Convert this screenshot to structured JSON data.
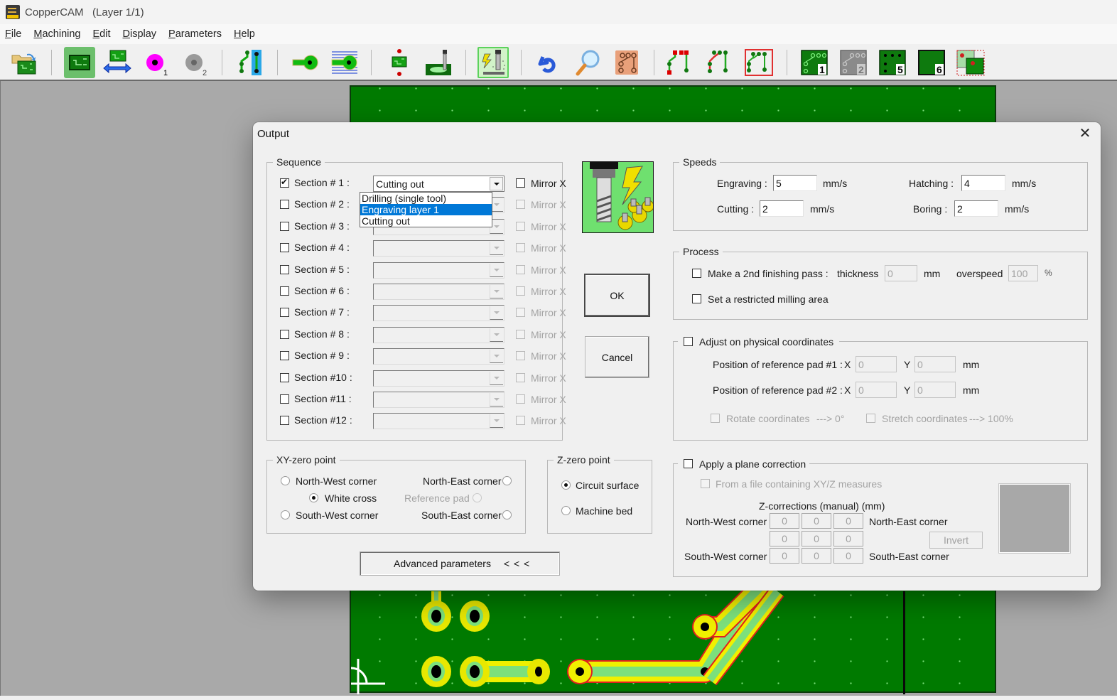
{
  "window": {
    "app_title": "CopperCAM",
    "layer_info": "(Layer 1/1)"
  },
  "menu": [
    {
      "label": "File",
      "accel": "F"
    },
    {
      "label": "Machining",
      "accel": "M"
    },
    {
      "label": "Edit",
      "accel": "E"
    },
    {
      "label": "Display",
      "accel": "D"
    },
    {
      "label": "Parameters",
      "accel": "P"
    },
    {
      "label": "Help",
      "accel": "H"
    }
  ],
  "toolbar": {
    "buttons": [
      {
        "icon": "open-folder-icon"
      },
      {
        "icon": "circuit-board-icon"
      },
      {
        "icon": "mirror-board-icon"
      },
      {
        "icon": "pad-layer-1-icon",
        "badge": "1"
      },
      {
        "icon": "pad-layer-2-icon",
        "badge": "2"
      },
      {
        "icon": "track-pad-icon"
      },
      {
        "icon": "pad-contour-icon"
      },
      {
        "icon": "pad-hatching-icon"
      },
      {
        "icon": "board-drill-icon"
      },
      {
        "icon": "cutting-tool-icon"
      },
      {
        "icon": "mill-output-icon"
      },
      {
        "icon": "undo-icon"
      },
      {
        "icon": "magnifier-icon"
      },
      {
        "icon": "copper-pcb-icon"
      },
      {
        "icon": "tracks-red-pads-icon"
      },
      {
        "icon": "tracks-red-lines-icon"
      },
      {
        "icon": "tracks-framed-icon"
      },
      {
        "icon": "layer-1-icon",
        "badge": "1"
      },
      {
        "icon": "layer-2-icon",
        "badge": "2"
      },
      {
        "icon": "layer-5-icon",
        "badge": "5"
      },
      {
        "icon": "layer-6-icon",
        "badge": "6"
      },
      {
        "icon": "board-offset-icon"
      }
    ]
  },
  "dialog": {
    "title": "Output",
    "close_glyph": "✕",
    "sequence": {
      "legend": "Sequence",
      "rows": [
        {
          "label": "Section # 1 :",
          "checked": true,
          "value": "Cutting out",
          "mirror_label": "Mirror X",
          "enabled": true
        },
        {
          "label": "Section # 2 :",
          "checked": false,
          "value": "",
          "mirror_label": "Mirror X",
          "enabled": false
        },
        {
          "label": "Section # 3 :",
          "checked": false,
          "value": "",
          "mirror_label": "Mirror X",
          "enabled": false
        },
        {
          "label": "Section # 4 :",
          "checked": false,
          "value": "",
          "mirror_label": "Mirror X",
          "enabled": false
        },
        {
          "label": "Section # 5 :",
          "checked": false,
          "value": "",
          "mirror_label": "Mirror X",
          "enabled": false
        },
        {
          "label": "Section # 6 :",
          "checked": false,
          "value": "",
          "mirror_label": "Mirror X",
          "enabled": false
        },
        {
          "label": "Section # 7 :",
          "checked": false,
          "value": "",
          "mirror_label": "Mirror X",
          "enabled": false
        },
        {
          "label": "Section # 8 :",
          "checked": false,
          "value": "",
          "mirror_label": "Mirror X",
          "enabled": false
        },
        {
          "label": "Section # 9 :",
          "checked": false,
          "value": "",
          "mirror_label": "Mirror X",
          "enabled": false
        },
        {
          "label": "Section #10 :",
          "checked": false,
          "value": "",
          "mirror_label": "Mirror X",
          "enabled": false
        },
        {
          "label": "Section #11 :",
          "checked": false,
          "value": "",
          "mirror_label": "Mirror X",
          "enabled": false
        },
        {
          "label": "Section #12 :",
          "checked": false,
          "value": "",
          "mirror_label": "Mirror X",
          "enabled": false
        }
      ],
      "dropdown_options": [
        "Drilling (single tool)",
        "Engraving layer 1",
        "Cutting out"
      ],
      "dropdown_highlighted": "Engraving layer 1"
    },
    "ok_label": "OK",
    "cancel_label": "Cancel",
    "speeds": {
      "legend": "Speeds",
      "engraving_label": "Engraving :",
      "engraving_value": "5",
      "hatching_label": "Hatching :",
      "hatching_value": "4",
      "cutting_label": "Cutting :",
      "cutting_value": "2",
      "boring_label": "Boring :",
      "boring_value": "2",
      "unit": "mm/s"
    },
    "process": {
      "legend": "Process",
      "finishing_pass_label": "Make a 2nd finishing pass :",
      "finishing_pass_checked": false,
      "thickness_label": "thickness",
      "thickness_value": "0",
      "thickness_unit": "mm",
      "overspeed_label": "overspeed",
      "overspeed_value": "100",
      "overspeed_unit": "%",
      "restricted_area_label": "Set a restricted milling area",
      "restricted_area_checked": false
    },
    "physical": {
      "legend": "Adjust on physical coordinates",
      "checked": false,
      "pad1_label": "Position of reference pad #1 :",
      "pad2_label": "Position of reference pad #2 :",
      "x_label": "X",
      "y_label": "Y",
      "unit": "mm",
      "pad1_x": "0",
      "pad1_y": "0",
      "pad2_x": "0",
      "pad2_y": "0",
      "rotate_label": "Rotate coordinates",
      "rotate_value": "---> 0°",
      "stretch_label": "Stretch coordinates",
      "stretch_value": "---> 100%"
    },
    "plane": {
      "legend": "Apply a plane correction",
      "checked": false,
      "from_file_label": "From a file containing XY/Z measures",
      "zcorr_title": "Z-corrections (manual) (mm)",
      "nw_label": "North-West corner",
      "ne_label": "North-East corner",
      "sw_label": "South-West corner",
      "se_label": "South-East corner",
      "grid": [
        [
          "0",
          "0",
          "0"
        ],
        [
          "0",
          "0",
          "0"
        ],
        [
          "0",
          "0",
          "0"
        ]
      ],
      "invert_label": "Invert"
    },
    "xy_zero": {
      "legend": "XY-zero point",
      "nw_label": "North-West corner",
      "ne_label": "North-East corner",
      "white_cross_label": "White cross",
      "reference_pad_label": "Reference pad",
      "sw_label": "South-West corner",
      "se_label": "South-East corner",
      "selected": "White cross"
    },
    "z_zero": {
      "legend": "Z-zero point",
      "circuit_label": "Circuit surface",
      "bed_label": "Machine bed",
      "selected": "Circuit surface"
    },
    "advanced_label": "Advanced parameters",
    "advanced_arrows": "< < <"
  },
  "colors": {
    "pcb_green": "#007a00",
    "track_yellow": "#f0f000",
    "track_light_green": "#7ce07c",
    "contour_red": "#e02020",
    "selection_blue": "#0078d7",
    "workspace_gray": "#a9a9a9"
  }
}
